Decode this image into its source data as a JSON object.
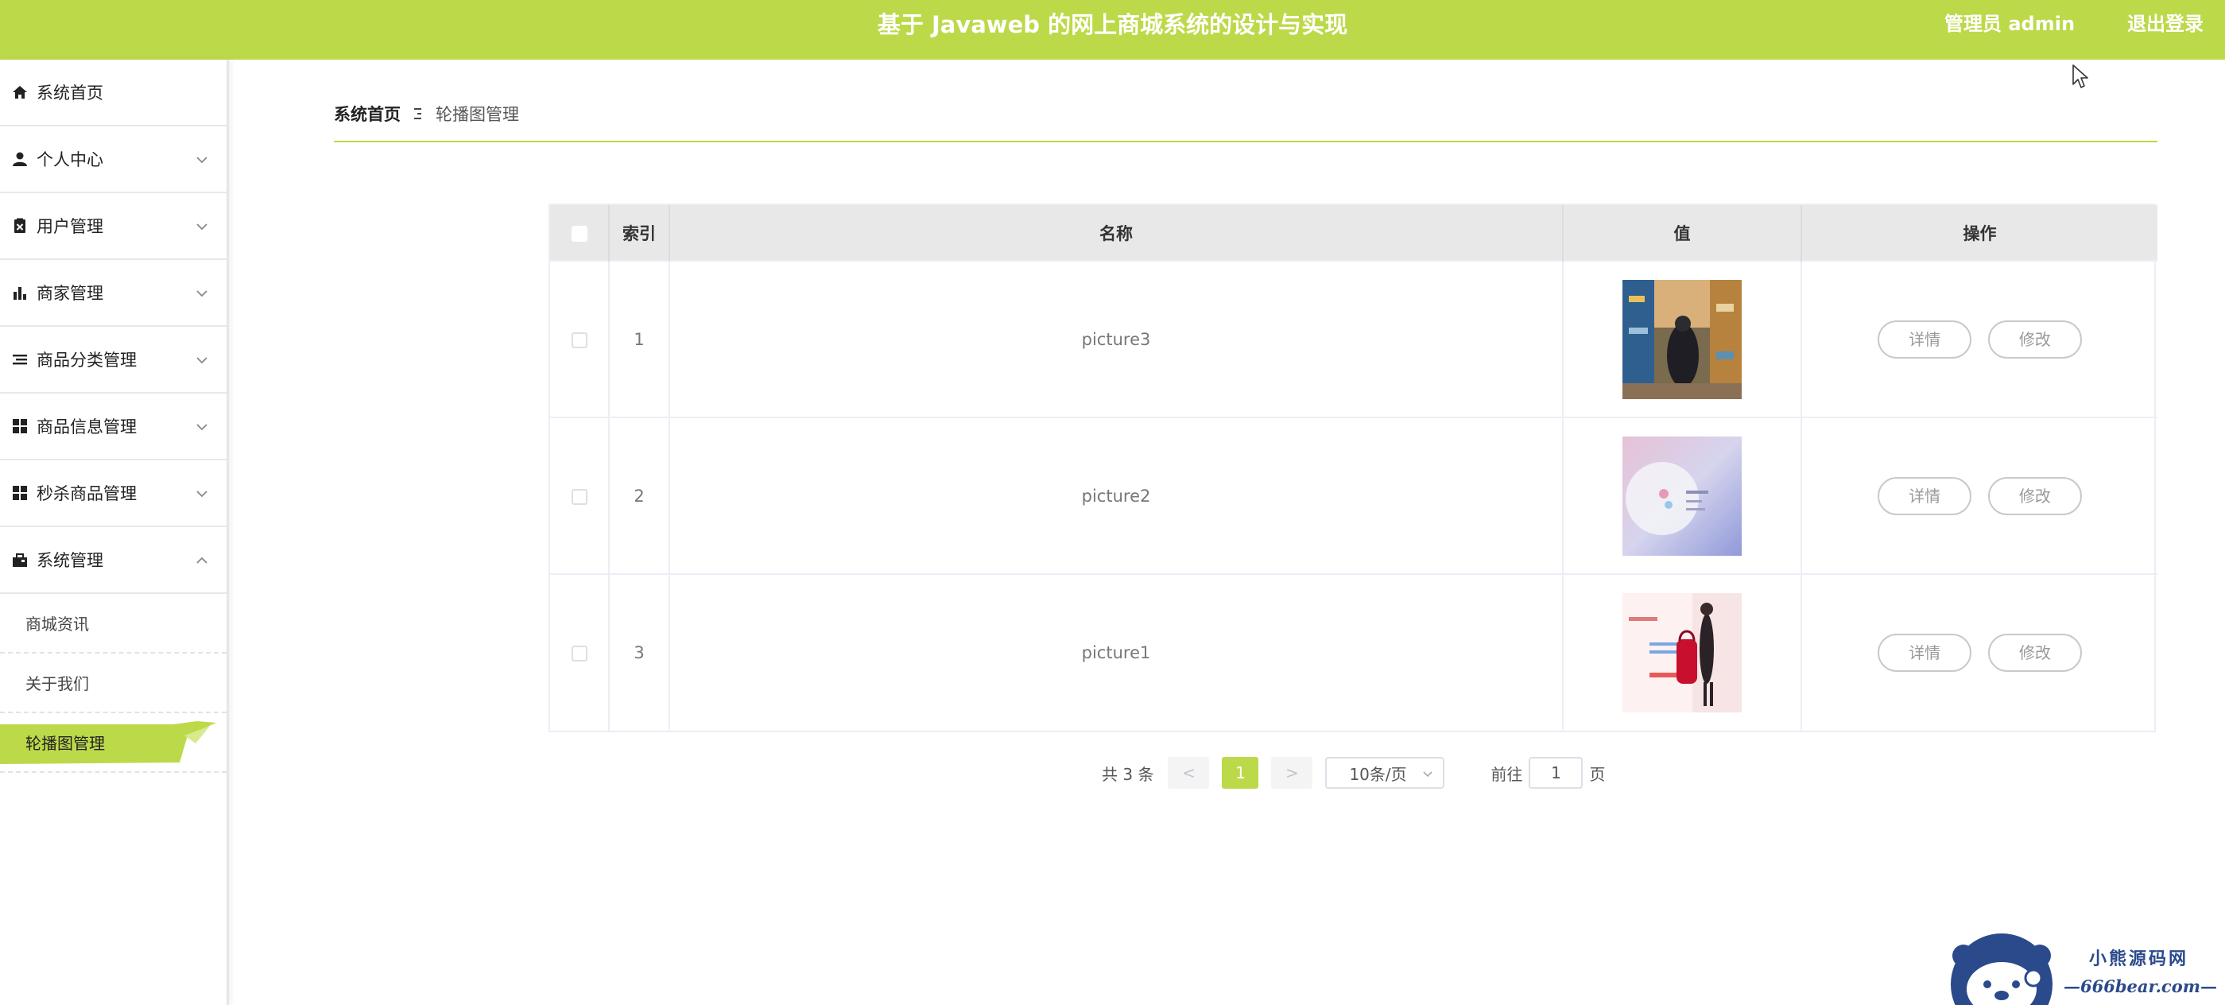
{
  "header": {
    "title": "基于 Javaweb 的网上商城系统的设计与实现",
    "user_label": "管理员 admin",
    "logout_label": "退出登录"
  },
  "sidebar": {
    "items": [
      {
        "label": "系统首页",
        "icon": "home-icon"
      },
      {
        "label": "个人中心",
        "icon": "user-icon"
      },
      {
        "label": "用户管理",
        "icon": "clipboard-icon"
      },
      {
        "label": "商家管理",
        "icon": "bar-chart-icon"
      },
      {
        "label": "商品分类管理",
        "icon": "list-icon"
      },
      {
        "label": "商品信息管理",
        "icon": "grid-icon"
      },
      {
        "label": "秒杀商品管理",
        "icon": "grid-icon"
      },
      {
        "label": "系统管理",
        "icon": "briefcase-icon"
      }
    ],
    "sub_items": [
      {
        "label": "商城资讯"
      },
      {
        "label": "关于我们"
      },
      {
        "label": "轮播图管理"
      }
    ]
  },
  "breadcrumb": {
    "home": "系统首页",
    "current": "轮播图管理"
  },
  "table": {
    "columns": [
      "索引",
      "名称",
      "值",
      "操作"
    ],
    "rows": [
      {
        "index": "1",
        "name": "picture3",
        "image": "bookstore-photo"
      },
      {
        "index": "2",
        "name": "picture2",
        "image": "banner-graphic"
      },
      {
        "index": "3",
        "name": "picture1",
        "image": "red-bag-photo"
      }
    ],
    "detail_label": "详情",
    "edit_label": "修改"
  },
  "pagination": {
    "total_text": "共 3 条",
    "prev": "<",
    "next": ">",
    "current_page": "1",
    "page_size": "10条/页",
    "goto_prefix": "前往",
    "goto_value": "1",
    "goto_suffix": "页"
  },
  "watermark": {
    "line1": "小熊源码网",
    "line2": "—666bear.com—"
  },
  "colors": {
    "accent": "#bcd94a",
    "header_text": "#ffffff"
  }
}
